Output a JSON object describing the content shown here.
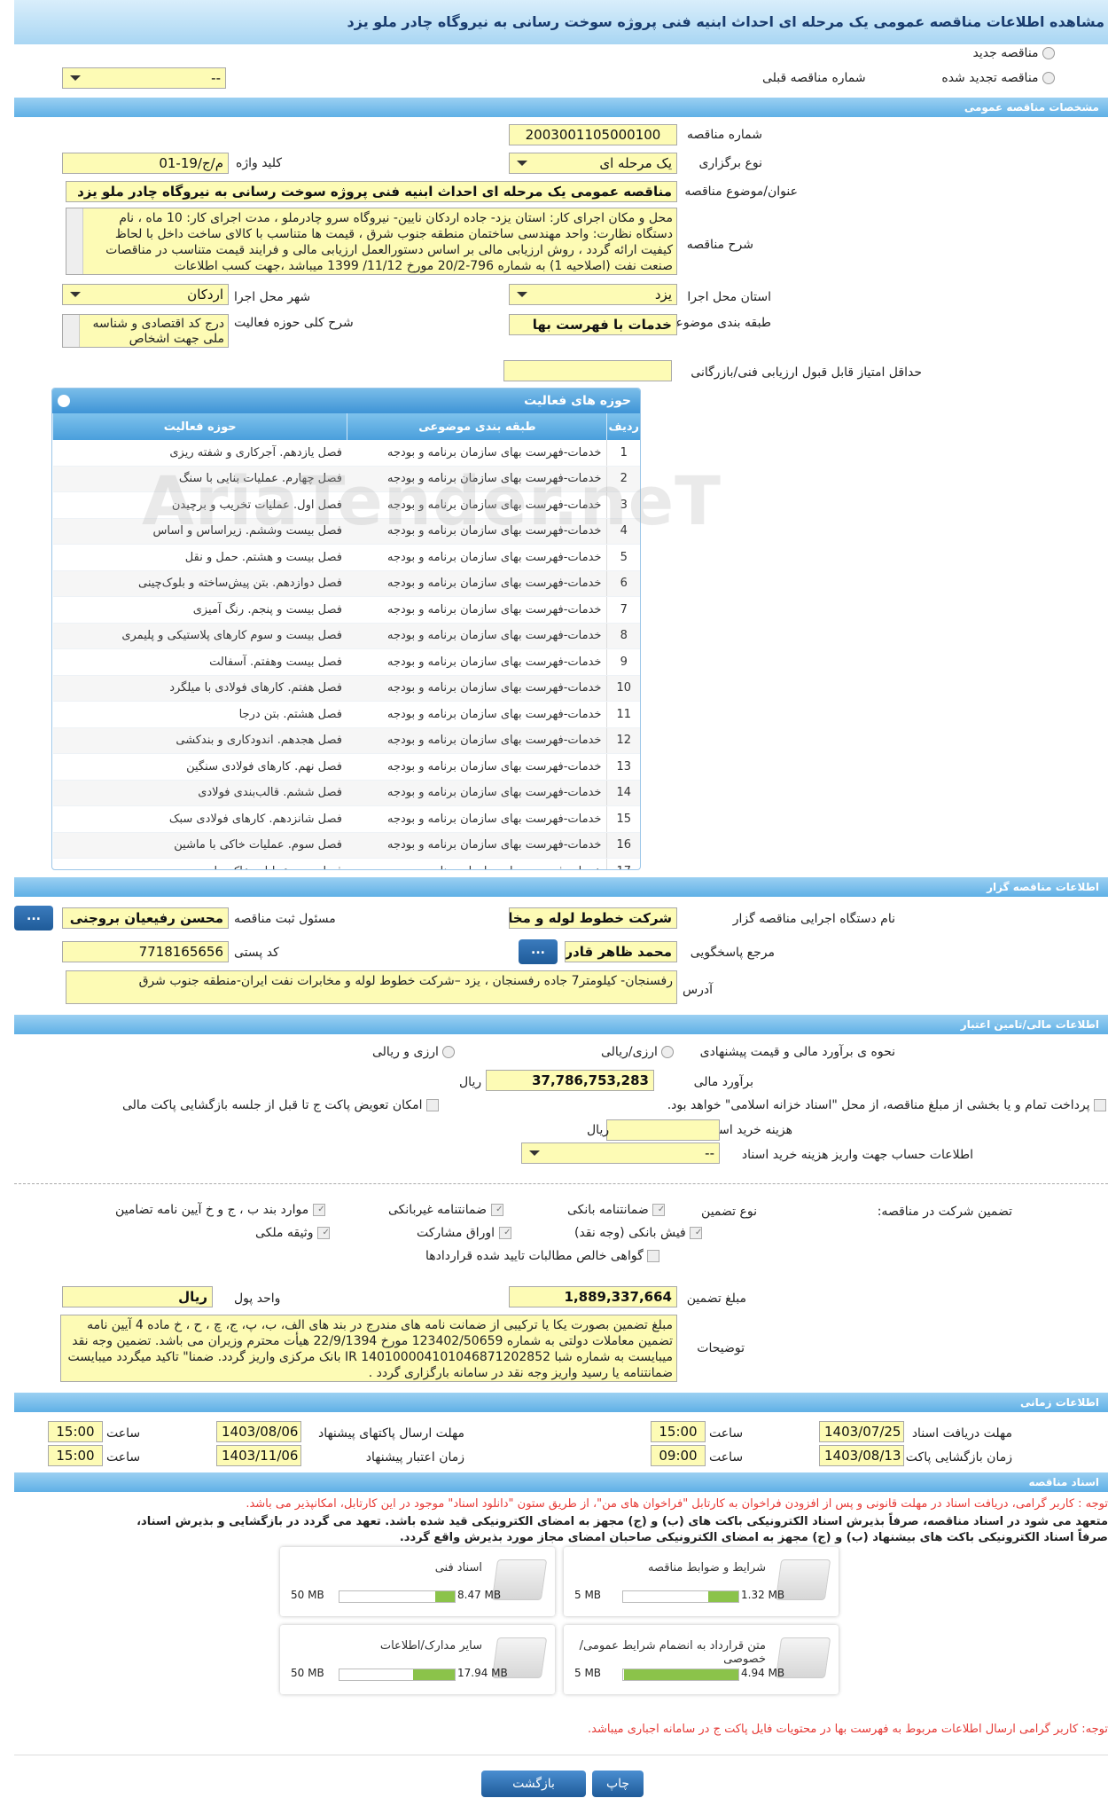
{
  "title": "مشاهده اطلاعات مناقصه عمومی یک مرحله ای احداث ابنیه فنی پروژه سوخت رسانی به نیروگاه چادر ملو یزد",
  "top": {
    "radio_new": "مناقصه جدید",
    "radio_renewed": "مناقصه تجدید شده",
    "prev_number_label": "شماره مناقصه قبلی",
    "prev_number_value": "--"
  },
  "general": {
    "header": "مشخصات مناقصه عمومی",
    "number_label": "شماره مناقصه",
    "number_value": "2003001105000100",
    "type_label": "نوع برگزاری",
    "type_value": "یک مرحله ای",
    "keyword_label": "کلید واژه",
    "keyword_value": "م/ج/19-01",
    "subject_label": "عنوان/موضوع مناقصه",
    "subject_value": "مناقصه عمومی یک مرحله ای احداث ابنیه فنی پروژه سوخت رسانی به نیروگاه چادر ملو یزد",
    "desc_label": "شرح مناقصه",
    "desc_value": "محل و مکان اجرای کار: استان یزد- جاده اردکان نایین- نیروگاه سرو چادرملو ، مدت اجرای کار: 10 ماه ، نام دستگاه نظارت: واحد مهندسی ساختمان منطقه جنوب شرق ، قیمت ها متناسب با کالای ساخت داخل با لحاظ کیفیت ارائه گردد ، روش ارزیابی مالی بر اساس دستورالعمل ارزیابی مالی و فرایند قیمت متناسب در مناقصات صنعت نفت (اصلاحیه 1) به شماره 796-20/2 مورخ 11/12/ 1399 میباشد ،جهت کسب اطلاعات",
    "province_label": "استان محل اجرا",
    "province_value": "یزد",
    "city_label": "شهر محل اجرا",
    "city_value": "اردکان",
    "category_label": "طبقه بندی موضوعی",
    "category_value": "خدمات با فهرست بها",
    "activity_label": "شرح کلی حوزه فعالیت",
    "activity_value": "درج کد اقتصادی و شناسه ملی جهت اشخاص",
    "min_score_label": "حداقل امتیاز قابل قبول ارزیابی فنی/بازرگانی",
    "min_score_value": ""
  },
  "activities": {
    "header": "حوزه های فعالیت",
    "columns": [
      "ردیف",
      "طبقه بندی موضوعی",
      "حوزه فعالیت"
    ],
    "rows": [
      [
        "1",
        "خدمات-فهرست بهای سازمان برنامه و بودجه",
        "فصل یازدهم. آجرکاری و شفته ریزی"
      ],
      [
        "2",
        "خدمات-فهرست بهای سازمان برنامه و بودجه",
        "فصل چهارم. عملیات بنایی با سنگ"
      ],
      [
        "3",
        "خدمات-فهرست بهای سازمان برنامه و بودجه",
        "فصل اول. عملیات تخریب و برچیدن"
      ],
      [
        "4",
        "خدمات-فهرست بهای سازمان برنامه و بودجه",
        "فصل بیست وششم. زیراساس و اساس"
      ],
      [
        "5",
        "خدمات-فهرست بهای سازمان برنامه و بودجه",
        "فصل بیست و هشتم. حمل و نقل"
      ],
      [
        "6",
        "خدمات-فهرست بهای سازمان برنامه و بودجه",
        "فصل دوازدهم. بتن پیش‌ساخته و بلوک‌چینی"
      ],
      [
        "7",
        "خدمات-فهرست بهای سازمان برنامه و بودجه",
        "فصل بیست و پنجم. رنگ آمیزی"
      ],
      [
        "8",
        "خدمات-فهرست بهای سازمان برنامه و بودجه",
        "فصل بیست و سوم کارهای پلاستیکی و پلیمری"
      ],
      [
        "9",
        "خدمات-فهرست بهای سازمان برنامه و بودجه",
        "فصل بیست وهفتم. آسفالت"
      ],
      [
        "10",
        "خدمات-فهرست بهای سازمان برنامه و بودجه",
        "فصل هفتم. کارهای فولادی با میلگرد"
      ],
      [
        "11",
        "خدمات-فهرست بهای سازمان برنامه و بودجه",
        "فصل هشتم. بتن درجا"
      ],
      [
        "12",
        "خدمات-فهرست بهای سازمان برنامه و بودجه",
        "فصل هجدهم. اندودکاری و بندکشی"
      ],
      [
        "13",
        "خدمات-فهرست بهای سازمان برنامه و بودجه",
        "فصل نهم. کارهای فولادی سنگین"
      ],
      [
        "14",
        "خدمات-فهرست بهای سازمان برنامه و بودجه",
        "فصل ششم. قالب‌بندی فولادی"
      ],
      [
        "15",
        "خدمات-فهرست بهای سازمان برنامه و بودجه",
        "فصل شانزدهم. کارهای فولادی سبک"
      ],
      [
        "16",
        "خدمات-فهرست بهای سازمان برنامه و بودجه",
        "فصل سوم. عملیات خاکی با ماشین"
      ],
      [
        "17",
        "خدمات-فهرست بهای سازمان برنامه و بودجه",
        "فصل دوم. عملیات خاکی با دست"
      ]
    ],
    "watermark": "AriaTender.neT"
  },
  "organizer": {
    "header": "اطلاعات مناقصه گزار",
    "org_label": "نام دستگاه اجرایی مناقصه گزار",
    "org_value": "شرکت خطوط لوله و مخابرات نفت ایران",
    "reg_label": "مسئول ثبت مناقصه",
    "reg_value": "محسن رفیعیان بروجنی",
    "ref_label": "مرجع پاسخگویی",
    "ref_value": "محمد ظاهر قادری",
    "postal_label": "کد پستی",
    "postal_value": "7718165656",
    "address_label": "آدرس",
    "address_value": "رفسنجان- کیلومتر7 جاده رفسنجان ، یزد –شرکت خطوط لوله و مخابرات نفت ایران-منطقه جنوب شرق",
    "dots": "..."
  },
  "finance": {
    "header": "اطلاعات مالی/تامین اعتبار",
    "estimate_type_label": "نحوه ی برآورد مالی و قیمت پیشنهادی",
    "opt_currency": "ارزی/ریالی",
    "opt_currency2": "ارزی و ریالی",
    "estimate_label": "برآورد مالی",
    "estimate_value": "37,786,753,283",
    "rial": "ریال",
    "treasury_text": "پرداخت تمام و یا بخشی از مبلغ مناقصه، از محل \"اسناد خزانه اسلامی\" خواهد بود.",
    "swap_text": "امکان تعویض پاکت ج تا قبل از جلسه بازگشایی پاکت مالی",
    "doc_cost_label": "هزینه خرید اسناد",
    "doc_cost_value": "",
    "account_label": "اطلاعات حساب جهت واریز هزینه خرید اسناد",
    "account_value": "--"
  },
  "guarantee": {
    "title_label": "تضمین شرکت در مناقصه:",
    "type_label": "نوع تضمین",
    "opt_bank": "ضمانتنامه بانکی",
    "opt_nonbank": "ضمانتنامه غیربانکی",
    "opt_items": "موارد بند ب ، ج و خ آیین نامه تضامین",
    "opt_check": "فیش بانکی (وجه نقد)",
    "opt_bonds": "اوراق مشارکت",
    "opt_property": "وثیقه ملکی",
    "opt_claims": "گواهی خالص مطالبات تایید شده قراردادها",
    "amount_label": "مبلغ تضمین",
    "amount_value": "1,889,337,664",
    "unit_label": "واحد پول",
    "unit_value": "ریال",
    "desc_label": "توضیحات",
    "desc_value": "مبلغ تضمین بصورت یکا یا ترکیبی از ضمانت نامه های مندرج در بند های الف، ب، پ، ج، چ ، ح ، خ ماده 4 آیین نامه تضمین معاملات دولتی به شماره 123402/50659 مورخ 22/9/1394 هیأت محترم وزیران می باشد. تضمین وجه نقد میبایست به شماره شبا IR 140100004101046871202852 بانک مرکزی واریز گردد. ضمنا\" تاکید میگردد میبایست ضمانتنامه یا رسید واریز وجه نقد در سامانه بارگزاری گردد ."
  },
  "timing": {
    "header": "اطلاعات زمانی",
    "recv_label": "مهلت دریافت اسناد",
    "recv_date": "1403/07/25",
    "recv_time": "15:00",
    "send_label": "مهلت ارسال پاکتهای پیشنهاد",
    "send_date": "1403/08/06",
    "send_time": "15:00",
    "open_label": "زمان بازگشایی پاکت ها",
    "open_date": "1403/08/13",
    "open_time": "09:00",
    "valid_label": "زمان اعتبار پیشنهاد",
    "valid_date": "1403/11/06",
    "valid_time": "15:00",
    "hour_label": "ساعت"
  },
  "docs": {
    "header": "اسناد مناقصه",
    "notice1": "توجه : کاربر گرامی، دریافت اسناد در مهلت قانونی و پس از افزودن فراخوان به کارتابل \"فراخوان های من\"، از طریق ستون \"دانلود اسناد\" موجود در این کارتابل، امکانپذیر می باشد.",
    "notice2": "متعهد می شود در اسناد مناقصه، صرفاً بذیرش اسناد الکترونیکی باکت های (ب) و (ج) مجهز به امضای الکترونیکی قید شده باشد. تعهد می گردد در بازگشایی و بذیرش اسناد،",
    "notice3": "صرفاً اسناد الکترونیکی باکت های بیشنهاد (ب) و (ج) مجهز به امضای الکترونیکی صاحبان امضای مجاز مورد بذیرش واقع گردد.",
    "cards": [
      {
        "title": "شرایط و ضوابط مناقصه",
        "used": "1.32 MB",
        "max": "5 MB",
        "fill": 0.26
      },
      {
        "title": "اسناد فنی",
        "used": "8.47 MB",
        "max": "50 MB",
        "fill": 0.17
      },
      {
        "title": "متن قرارداد به انضمام شرایط عمومی/خصوصی",
        "used": "4.94 MB",
        "max": "5 MB",
        "fill": 0.99
      },
      {
        "title": "سایر مدارک/اطلاعات",
        "used": "17.94 MB",
        "max": "50 MB",
        "fill": 0.36
      }
    ],
    "notice4": "توجه: کاربر گرامی ارسال اطلاعات مربوط به فهرست بها در محتویات فایل پاکت ج در سامانه اجباری میباشد."
  },
  "footer": {
    "back": "بازگشت",
    "print": "چاپ"
  }
}
